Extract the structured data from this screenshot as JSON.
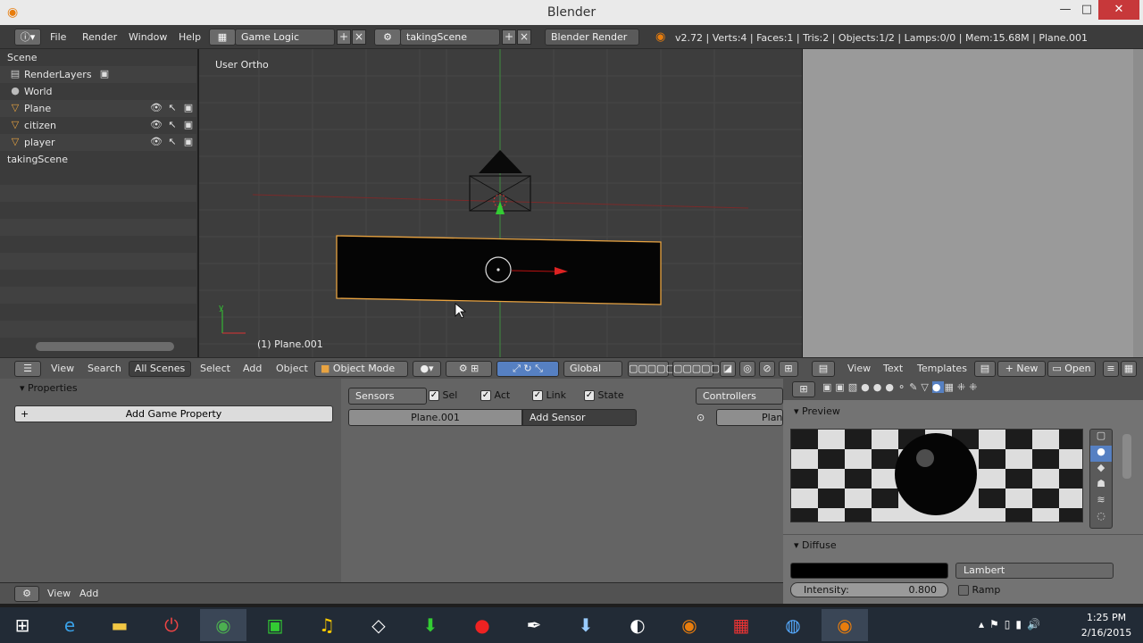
{
  "window": {
    "title": "Blender",
    "minimize": "—",
    "maximize": "□",
    "close": "✕"
  },
  "topbar": {
    "menus": [
      "File",
      "Render",
      "Window",
      "Help"
    ],
    "screen_layout": "Game Logic",
    "scene": "takingScene",
    "engine": "Blender Render",
    "stats": "v2.72 | Verts:4 | Faces:1 | Tris:2 | Objects:1/2 | Lamps:0/0 | Mem:15.68M | Plane.001"
  },
  "outliner": {
    "items": [
      {
        "label": "Scene"
      },
      {
        "label": "RenderLayers"
      },
      {
        "label": "World"
      },
      {
        "label": "Plane"
      },
      {
        "label": "citizen"
      },
      {
        "label": "player"
      },
      {
        "label": "takingScene"
      }
    ],
    "header": {
      "view": "View",
      "search": "Search",
      "scenes": "All Scenes"
    }
  },
  "viewport": {
    "view_label": "User Ortho",
    "object_label": "(1) Plane.001",
    "axis_y": "y",
    "header": {
      "select": "Select",
      "add": "Add",
      "object": "Object",
      "mode": "Object Mode",
      "orientation": "Global"
    }
  },
  "texteditor": {
    "header": {
      "view": "View",
      "text": "Text",
      "templates": "Templates",
      "new": "New",
      "open": "Open"
    }
  },
  "logic": {
    "properties_title": "Properties",
    "add_game_property": "Add Game Property",
    "sensors": "Sensors",
    "sel": "Sel",
    "act": "Act",
    "link": "Link",
    "state": "State",
    "object_name": "Plane.001",
    "add_sensor": "Add Sensor",
    "controllers": "Controllers",
    "controller_object": "Plane",
    "footer": {
      "view": "View",
      "add": "Add"
    }
  },
  "material": {
    "preview_title": "Preview",
    "diffuse_title": "Diffuse",
    "shader": "Lambert",
    "intensity_label": "Intensity:",
    "intensity_value": "0.800",
    "ramp": "Ramp"
  },
  "taskbar": {
    "time": "1:25 PM",
    "date": "2/16/2015"
  },
  "colors": {
    "accent": "#5680c2",
    "selection_outline": "#e8a341",
    "close_button": "#c7383a"
  }
}
